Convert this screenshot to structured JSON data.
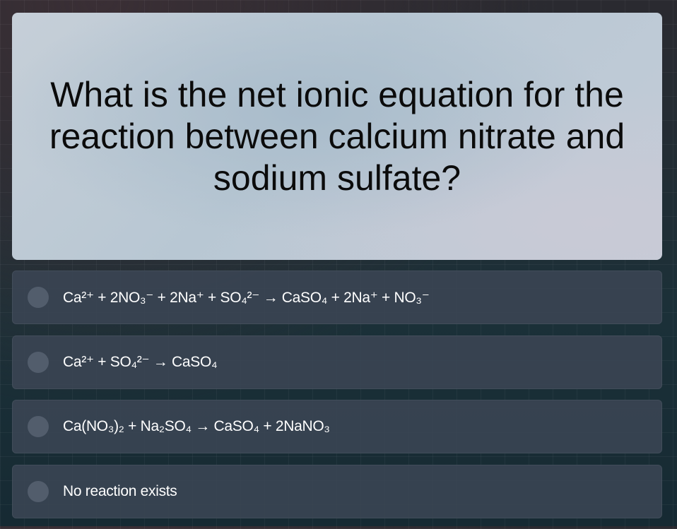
{
  "question": {
    "text": "What is the net ionic equation for the reaction between calcium nitrate and sodium sulfate?"
  },
  "options": [
    {
      "label": "Ca²⁺ + 2NO₃⁻ + 2Na⁺ + SO₄²⁻ → CaSO₄ + 2Na⁺ + NO₃⁻"
    },
    {
      "label": "Ca²⁺ + SO₄²⁻ → CaSO₄"
    },
    {
      "label": "Ca(NO₃)₂ + Na₂SO₄ → CaSO₄ + 2NaNO₃"
    },
    {
      "label": "No reaction exists"
    }
  ]
}
